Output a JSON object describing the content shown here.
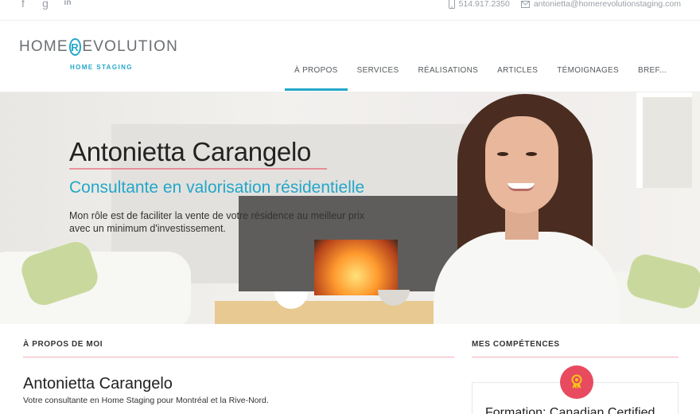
{
  "topbar": {
    "social": [
      {
        "icon": "facebook-icon",
        "glyph": "f"
      },
      {
        "icon": "google-plus-icon",
        "glyph": "g"
      },
      {
        "icon": "linkedin-icon",
        "glyph": "in"
      }
    ],
    "phone": "514.917.2350",
    "email": "antonietta@homerevolutionstaging.com"
  },
  "logo": {
    "left": "HOME",
    "r": "R",
    "right": "EVOLUTION",
    "sub": "HOME STAGING"
  },
  "nav": {
    "tabs": [
      {
        "label": "À PROPOS"
      },
      {
        "label": "SERVICES"
      },
      {
        "label": "RÉALISATIONS"
      },
      {
        "label": "ARTICLES"
      },
      {
        "label": "TÉMOIGNAGES"
      },
      {
        "label": "BREF..."
      }
    ]
  },
  "hero": {
    "title": "Antonietta Carangelo",
    "subtitle": "Consultante en valorisation résidentielle",
    "description": "Mon rôle est de faciliter la vente de votre résidence au meilleur prix avec un minimum d'investissement."
  },
  "about": {
    "heading": "À PROPOS DE MOI",
    "name": "Antonietta Carangelo",
    "tagline": "Votre consultante en Home Staging pour Montréal et la Rive-Nord."
  },
  "skills": {
    "heading": "MES COMPÉTENCES",
    "card_title": "Formation: Canadian Certified"
  },
  "colors": {
    "accent": "#23a7c9",
    "rule": "#e84a5f",
    "badge": "#e84a5f"
  }
}
